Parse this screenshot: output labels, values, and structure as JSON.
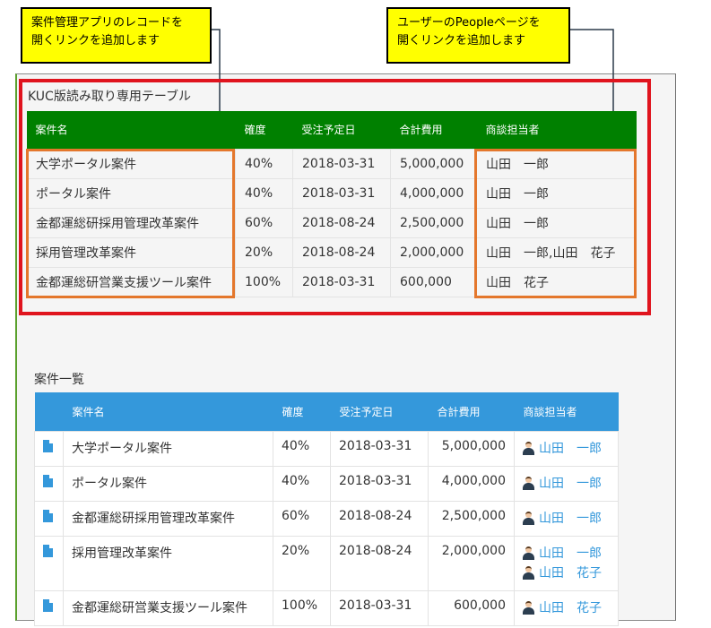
{
  "callouts": {
    "left": {
      "line1": "案件管理アプリのレコードを",
      "line2": "開くリンクを追加します"
    },
    "right": {
      "line1": "ユーザーのPeopleページを",
      "line2": "開くリンクを追加します"
    }
  },
  "kuc_table": {
    "title": "KUC版読み取り専用テーブル",
    "headers": [
      "案件名",
      "確度",
      "受注予定日",
      "合計費用",
      "商談担当者"
    ],
    "rows": [
      [
        "大学ポータル案件",
        "40%",
        "2018-03-31",
        "5,000,000",
        "山田　一郎"
      ],
      [
        "ポータル案件",
        "40%",
        "2018-03-31",
        "4,000,000",
        "山田　一郎"
      ],
      [
        "金都運総研採用管理改革案件",
        "60%",
        "2018-08-24",
        "2,500,000",
        "山田　一郎"
      ],
      [
        "採用管理改革案件",
        "20%",
        "2018-08-24",
        "2,000,000",
        "山田　一郎,山田　花子"
      ],
      [
        "金都運総研営業支援ツール案件",
        "100%",
        "2018-03-31",
        "600,000",
        "山田　花子"
      ]
    ]
  },
  "list_table": {
    "title": "案件一覧",
    "headers": [
      "",
      "案件名",
      "確度",
      "受注予定日",
      "合計費用",
      "商談担当者"
    ],
    "rows": [
      {
        "name": "大学ポータル案件",
        "prob": "40%",
        "date": "2018-03-31",
        "cost": "5,000,000",
        "users": [
          "山田　一郎"
        ]
      },
      {
        "name": "ポータル案件",
        "prob": "40%",
        "date": "2018-03-31",
        "cost": "4,000,000",
        "users": [
          "山田　一郎"
        ]
      },
      {
        "name": "金都運総研採用管理改革案件",
        "prob": "60%",
        "date": "2018-08-24",
        "cost": "2,500,000",
        "users": [
          "山田　一郎"
        ]
      },
      {
        "name": "採用管理改革案件",
        "prob": "20%",
        "date": "2018-08-24",
        "cost": "2,000,000",
        "users": [
          "山田　一郎",
          "山田　花子"
        ]
      },
      {
        "name": "金都運総研営業支援ツール案件",
        "prob": "100%",
        "date": "2018-03-31",
        "cost": "600,000",
        "users": [
          "山田　花子"
        ]
      }
    ]
  },
  "icons": {
    "record": "document-icon",
    "user": "user-avatar-icon"
  },
  "colors": {
    "kuc_header": "#008000",
    "list_header": "#3498db",
    "highlight_red": "#e0141e",
    "highlight_orange": "#e4772c",
    "callout": "#ffff00"
  }
}
